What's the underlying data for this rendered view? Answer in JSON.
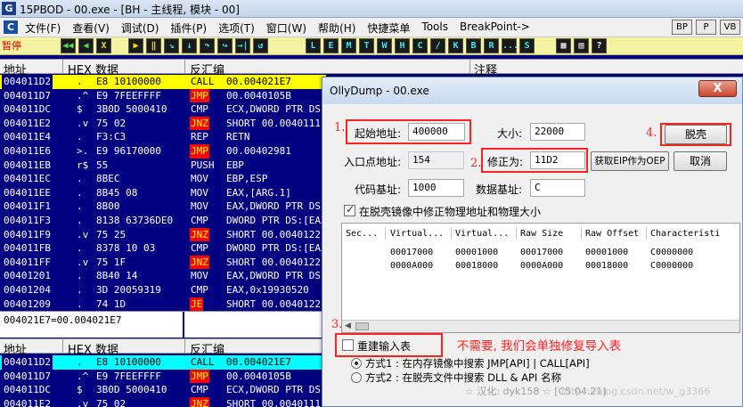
{
  "window": {
    "title": "15PBOD - 00.exe - [BH - 主线程, 模块 - 00]",
    "menu_logo": "C",
    "logo": "G"
  },
  "menu": {
    "items": [
      "文件(F)",
      "查看(V)",
      "调试(D)",
      "插件(P)",
      "选项(T)",
      "窗口(W)",
      "帮助(H)",
      "快捷菜单",
      "Tools",
      "BreakPoint->"
    ],
    "right_buttons": [
      "BP",
      "P",
      "VB"
    ]
  },
  "toolbar": {
    "status": "暂停",
    "left_buttons": [
      "◀◀",
      "◀",
      "X",
      "▶",
      "‖",
      "↘",
      "↓",
      "↷",
      "↪",
      "→|",
      "↺"
    ],
    "mid_buttons": [
      "L",
      "E",
      "M",
      "T",
      "W",
      "H",
      "C",
      "/",
      "K",
      "B",
      "R",
      "...",
      "S"
    ],
    "right_buttons": [
      "▦",
      "▤",
      "?"
    ]
  },
  "cpu": {
    "headers": {
      "addr": "地址",
      "hex": "HEX 数据",
      "disasm": "反汇编",
      "comment": "注释"
    },
    "rows": [
      {
        "addr": "004011D2",
        "mark": ".",
        "hex": "E8 10100000",
        "mn": "CALL",
        "ops": "00.004021E7",
        "sel": true,
        "hl": false
      },
      {
        "addr": "004011D7",
        "mark": ".^",
        "hex": "E9 7FEEFFFF",
        "mn": "JMP",
        "ops": "00.0040105B",
        "hl": true
      },
      {
        "addr": "004011DC",
        "mark": "$",
        "hex": "3B0D 5000410",
        "mn": "CMP",
        "ops": "ECX,DWORD PTR DS:[",
        "hl": false
      },
      {
        "addr": "004011E2",
        "mark": ".v",
        "hex": "75 02",
        "mn": "JNZ",
        "ops": "SHORT 00.0040111",
        "hl": true
      },
      {
        "addr": "004011E4",
        "mark": ".",
        "hex": "F3:C3",
        "mn": "REP",
        "ops": "RETN",
        "hl": false
      },
      {
        "addr": "004011E6",
        "mark": ">.",
        "hex": "E9 96170000",
        "mn": "JMP",
        "ops": "00.00402981",
        "hl": true
      },
      {
        "addr": "004011EB",
        "mark": "r$",
        "hex": "55",
        "mn": "PUSH",
        "ops": "EBP",
        "hl": false
      },
      {
        "addr": "004011EC",
        "mark": ".",
        "hex": "8BEC",
        "mn": "MOV",
        "ops": "EBP,ESP",
        "hl": false
      },
      {
        "addr": "004011EE",
        "mark": ".",
        "hex": "8B45 08",
        "mn": "MOV",
        "ops": "EAX,[ARG.1]",
        "hl": false
      },
      {
        "addr": "004011F1",
        "mark": ".",
        "hex": "8B00",
        "mn": "MOV",
        "ops": "EAX,DWORD PTR DS:[",
        "hl": false
      },
      {
        "addr": "004011F3",
        "mark": ".",
        "hex": "8138 63736DE0",
        "mn": "CMP",
        "ops": "DWORD PTR DS:[EAX]",
        "hl": false
      },
      {
        "addr": "004011F9",
        "mark": ".v",
        "hex": "75 25",
        "mn": "JNZ",
        "ops": "SHORT 00.0040122",
        "hl": true
      },
      {
        "addr": "004011FB",
        "mark": ".",
        "hex": "8378 10 03",
        "mn": "CMP",
        "ops": "DWORD PTR DS:[EAX+",
        "hl": false
      },
      {
        "addr": "004011FF",
        "mark": ".v",
        "hex": "75 1F",
        "mn": "JNZ",
        "ops": "SHORT 00.0040122",
        "hl": true
      },
      {
        "addr": "00401201",
        "mark": ".",
        "hex": "8B40 14",
        "mn": "MOV",
        "ops": "EAX,DWORD PTR DS:[",
        "hl": false
      },
      {
        "addr": "00401204",
        "mark": ".",
        "hex": "3D 20059319",
        "mn": "CMP",
        "ops": "EAX,0x19930520",
        "hl": false
      },
      {
        "addr": "00401209",
        "mark": ".",
        "hex": "74 1D",
        "mn": "JE",
        "ops": "SHORT 00.0040122",
        "hl": true
      }
    ],
    "info_line": "004021E7=00.004021E7",
    "rows2": [
      {
        "addr": "004011D2",
        "mark": ".",
        "hex": "E8 10100000",
        "mn": "CALL",
        "ops": "00.004021E7",
        "sel": true,
        "hl": false
      },
      {
        "addr": "004011D7",
        "mark": ".^",
        "hex": "E9 7FEEFFFF",
        "mn": "JMP",
        "ops": "00.0040105B",
        "hl": true
      },
      {
        "addr": "004011DC",
        "mark": "$",
        "hex": "3B0D 5000410",
        "mn": "CMP",
        "ops": "ECX,DWORD PTR DS:[",
        "hl": false
      },
      {
        "addr": "004011E2",
        "mark": ".v",
        "hex": "75 02",
        "mn": "JNZ",
        "ops": "SHORT 00.0040111",
        "hl": true
      }
    ]
  },
  "dialog": {
    "title": "OllyDump - 00.exe",
    "close": "X",
    "start_addr_label": "起始地址:",
    "start_addr_value": "400000",
    "size_label": "大小:",
    "size_value": "22000",
    "dump_button": "脱壳",
    "entry_label": "入口点地址:",
    "entry_value": "154",
    "correct_label": "修正为:",
    "correct_value": "11D2",
    "get_eip_button": "获取EIP作为OEP",
    "cancel_button": "取消",
    "code_base_label": "代码基址:",
    "code_base_value": "1000",
    "data_base_label": "数据基址:",
    "data_base_value": "C",
    "fix_checkbox_label": "在脱壳镜像中修正物理地址和物理大小",
    "fix_checked": true,
    "sections": {
      "headers": [
        "Sec...",
        "Virtual...",
        "Virtual...",
        "Raw Size",
        "Raw Offset",
        "Characteristi"
      ],
      "rows": [
        [
          "",
          "00017000",
          "00001000",
          "00017000",
          "00001000",
          "C0000000"
        ],
        [
          "",
          "0000A000",
          "00018000",
          "0000A000",
          "00018000",
          "C0000000"
        ]
      ]
    },
    "rebuild_label": "重建输入表",
    "rebuild_checked": false,
    "method1": "方式1 : 在内存镜像中搜索 JMP[API] | CALL[API]",
    "method2": "方式2 : 在脱壳文件中搜索 DLL & API 名称",
    "watermark": "☆ 汉化: dyk158 ☆ [C5.04.21]",
    "csdn": "https://blog.csdn.net/w_g3366"
  },
  "annotations": {
    "n1": "1.",
    "n2": "2.",
    "n3": "3.",
    "n4": "4.",
    "note": "不需要, 我们会单独修复导入表"
  },
  "colors": {
    "bg": "#000080",
    "accent_red": "#ff2020",
    "selection": "#ffff00",
    "selection2": "#00ffff"
  }
}
